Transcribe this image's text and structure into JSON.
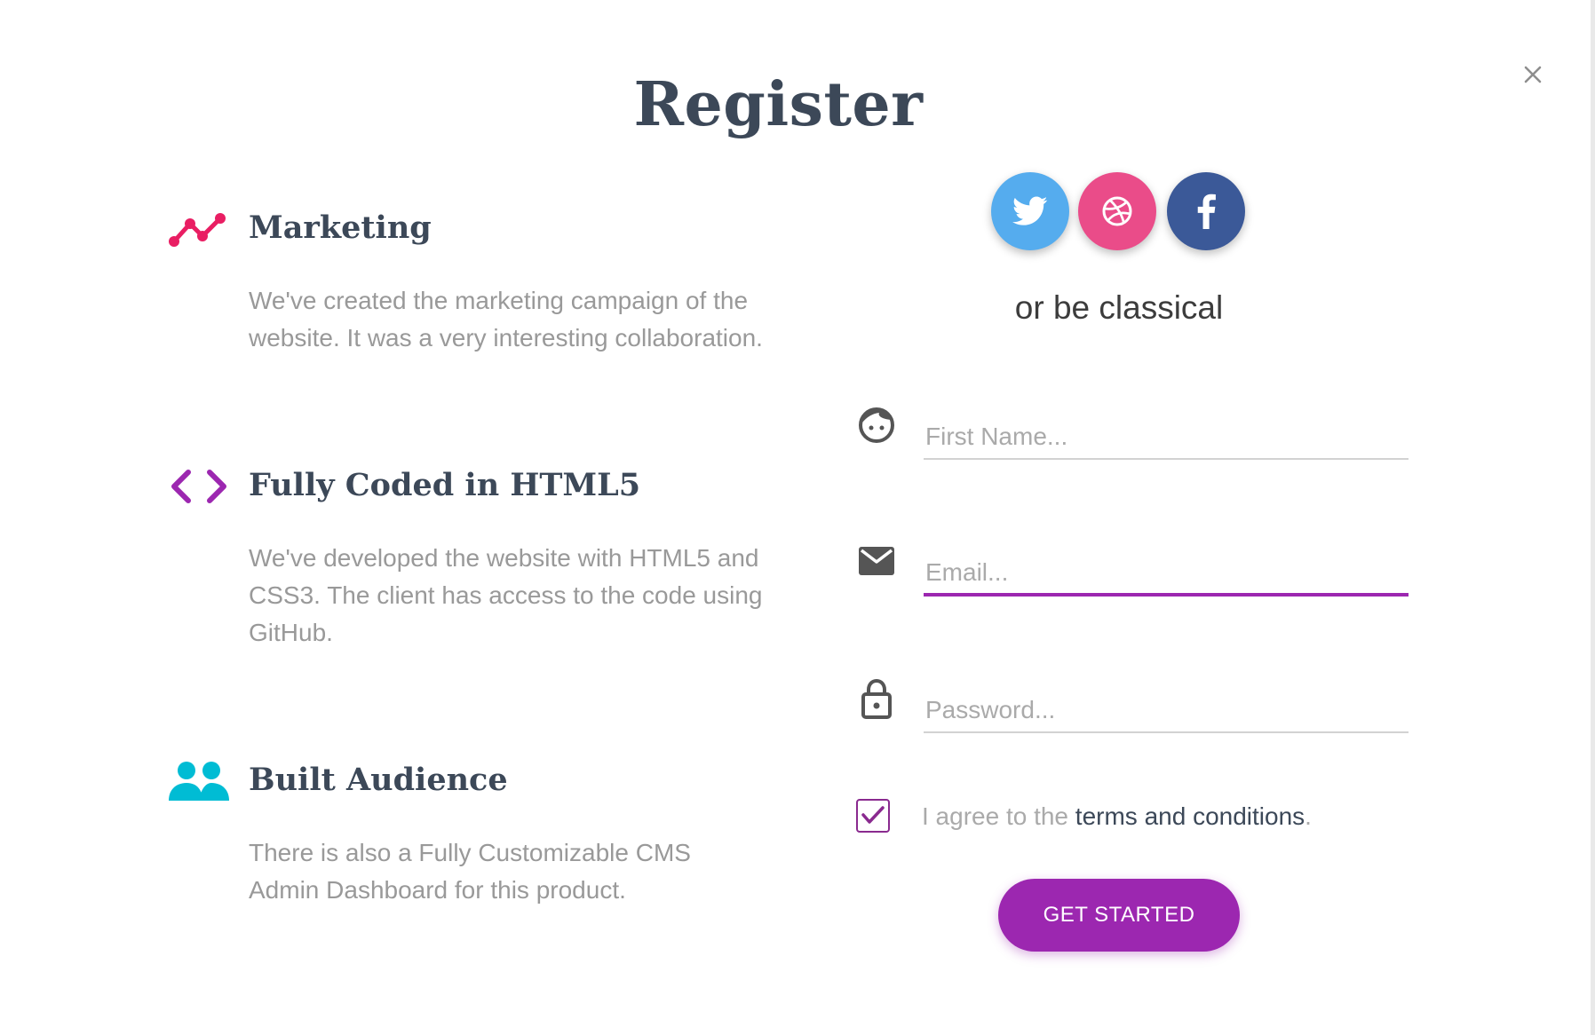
{
  "modal": {
    "title": "Register",
    "close_icon": "close-icon"
  },
  "features": [
    {
      "icon": "timeline-icon",
      "icon_color": "#e91e63",
      "heading": "Marketing",
      "description": "We've created the marketing campaign of the website. It was a very interesting collaboration."
    },
    {
      "icon": "code-icon",
      "icon_color": "#9c27b0",
      "heading": "Fully Coded in HTML5",
      "description": "We've developed the website with HTML5 and CSS3. The client has access to the code using GitHub."
    },
    {
      "icon": "group-icon",
      "icon_color": "#00bcd4",
      "heading": "Built Audience",
      "description": "There is also a Fully Customizable CMS Admin Dashboard for this product."
    }
  ],
  "social": [
    {
      "name": "twitter",
      "icon": "twitter-icon",
      "color": "#55acee"
    },
    {
      "name": "dribbble",
      "icon": "dribbble-icon",
      "color": "#ea4c89"
    },
    {
      "name": "facebook",
      "icon": "facebook-icon",
      "color": "#3b5998"
    }
  ],
  "divider_text": "or be classical",
  "form": {
    "first_name": {
      "icon": "face-icon",
      "placeholder": "First Name...",
      "value": ""
    },
    "email": {
      "icon": "mail-icon",
      "placeholder": "Email...",
      "value": "",
      "focused": true
    },
    "password": {
      "icon": "lock-icon",
      "placeholder": "Password...",
      "value": ""
    },
    "agree": {
      "checked": true,
      "prefix": "I agree to the ",
      "link": "terms and conditions",
      "suffix": "."
    },
    "submit_label": "GET STARTED"
  },
  "colors": {
    "accent": "#9c27b0",
    "heading": "#3c4858",
    "muted": "#999999"
  }
}
